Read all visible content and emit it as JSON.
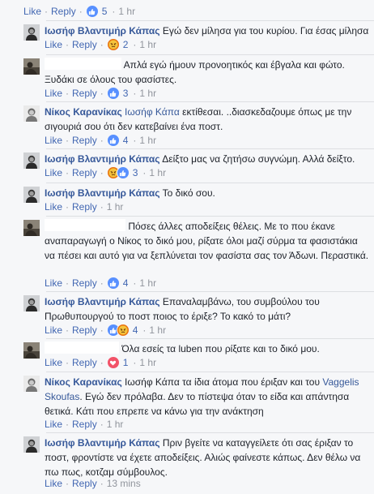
{
  "first_actions": {
    "like": "Like",
    "reply": "Reply",
    "count": "5",
    "time": "1 hr"
  },
  "comments": [
    {
      "author": "Ιωσήφ Βλαντιμήρ Κάπας",
      "text": "Εγώ δεν μίλησα για του κυρίου. Για έσας μίλησα",
      "count": "2",
      "time": "1 hr"
    },
    {
      "text": "Απλά εγώ ήμουν προνοητικός και έβγαλα και φώτο. Ξυδάκι σε όλους του φασίστες.",
      "count": "3",
      "time": "1 hr"
    },
    {
      "author": "Νίκος Καρανίκας",
      "mention": "Ιωσήφ Κάπα",
      "text": "εκτίθεσαι. ..διασκεδαζουμε όπως με την σιγουριά σου ότι δεν κατεβαίνει ένα ποστ.",
      "count": "4",
      "time": "1 hr"
    },
    {
      "author": "Ιωσήφ Βλαντιμήρ Κάπας",
      "text": "Δείξτο μας να ζητήσω συγνώμη. Αλλά δείξτο.",
      "count": "3",
      "time": "1 hr"
    },
    {
      "author": "Ιωσήφ Βλαντιμήρ Κάπας",
      "text": "Το δικό σου.",
      "time": "1 hr"
    },
    {
      "text": "Πόσες άλλες αποδείξεις θέλεις. Με το που έκανε αναπαραγωγή ο Νίκος το δικό μου, ρίξατε όλοι μαζί σύρμα τα φασιστάκια να πέσει και αυτό για να ξεπλύνεται τον φασίστα σας τον Άδωνι. Περαστικά.",
      "count": "4",
      "time": "1 hr"
    },
    {
      "author": "Ιωσήφ Βλαντιμήρ Κάπας",
      "text": "Επαναλαμβάνω, του συμβούλου του Πρωθυπουργού το ποστ ποιος το έριξε? Το κακό το μάτι?",
      "count": "4",
      "time": "1 hr"
    },
    {
      "text": "Όλα εσείς τα luben που ρίξατε και το δικό μου.",
      "count": "1",
      "time": "1 hr"
    },
    {
      "author": "Νίκος Καρανίκας",
      "text_a": "Ιωσήφ Κάπα τα ίδια άτομα που έριξαν και του",
      "mention": "Vaggelis Skoufas",
      "text_b": ". Εγώ δεν πρόλαβα. Δεν το πίστεψα όταν το είδα και απάντησα θετικά. Κάτι που επρεπε να κάνω για την ανάκτηση",
      "time": "1 hr"
    },
    {
      "author": "Ιωσήφ Βλαντιμήρ Κάπας",
      "text": "Πριν βγείτε να καταγγείλετε ότι σας έριξαν το ποστ, φροντίστε να έχετε αποδείξεις. Αλιώς φαίνεστε κάπως. Δεν θέλω να πω πως, κοτζαμ σύμβουλος.",
      "time": "13 mins"
    }
  ],
  "labels": {
    "like": "Like",
    "reply": "Reply"
  },
  "colors": {
    "link": "#365899",
    "meta": "#90949c",
    "like": "#5890ff",
    "angry": "#e9710f",
    "love": "#f25268"
  }
}
